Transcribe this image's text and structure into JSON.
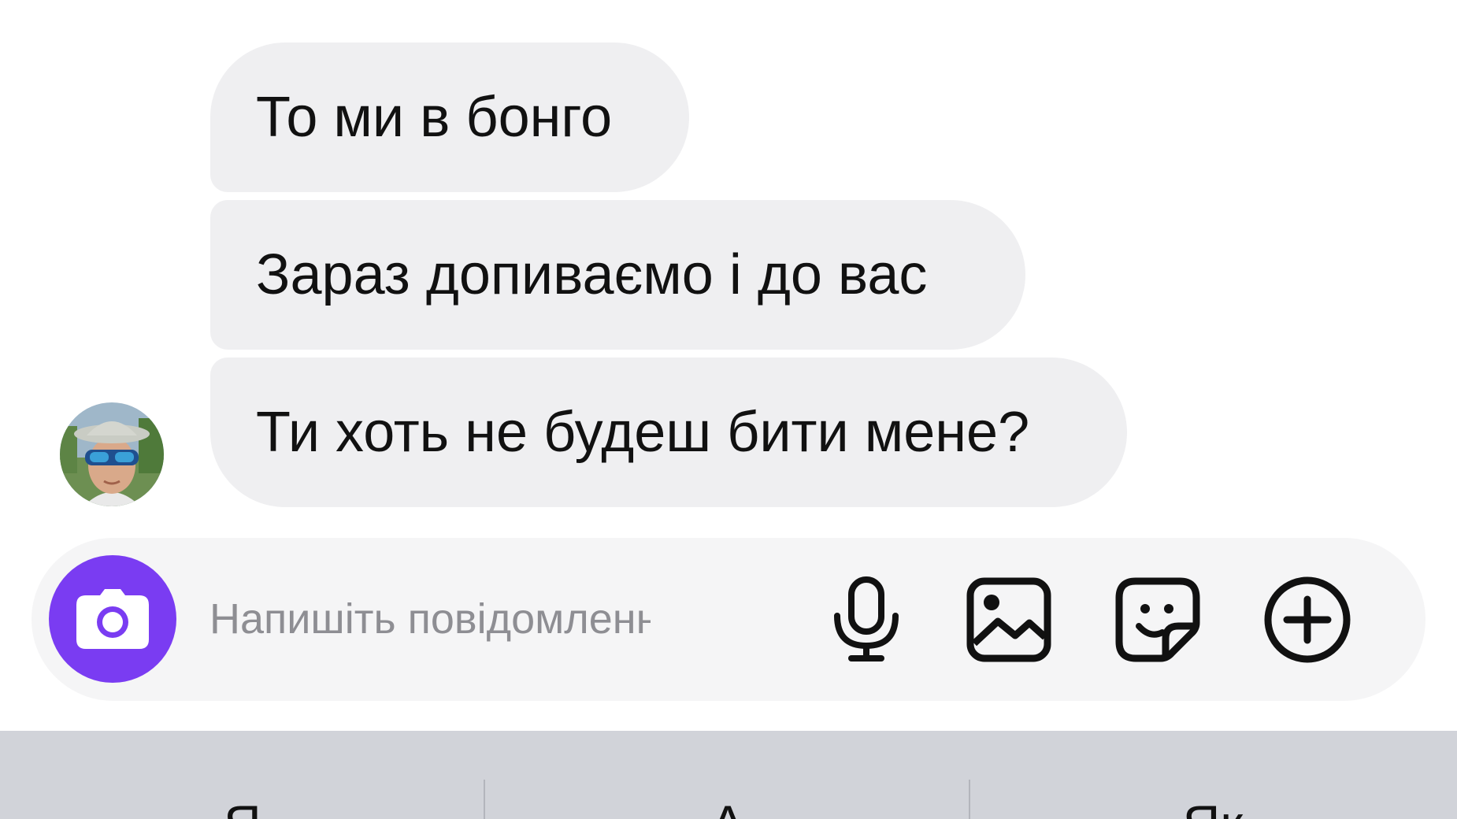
{
  "conversation": {
    "messages": [
      {
        "text": "То ми в бонго"
      },
      {
        "text": "Зараз допиваємо і до вас"
      },
      {
        "text": "Ти хоть не будеш бити мене?"
      }
    ]
  },
  "composer": {
    "placeholder": "Напишіть повідомлення...",
    "icons": {
      "camera": "camera-icon",
      "microphone": "microphone-icon",
      "gallery": "image-icon",
      "sticker": "sticker-icon",
      "more": "plus-circle-icon"
    },
    "accent_color": "#7a3cf2"
  },
  "keyboard": {
    "suggestions": [
      "Я",
      "А",
      "Як"
    ]
  }
}
